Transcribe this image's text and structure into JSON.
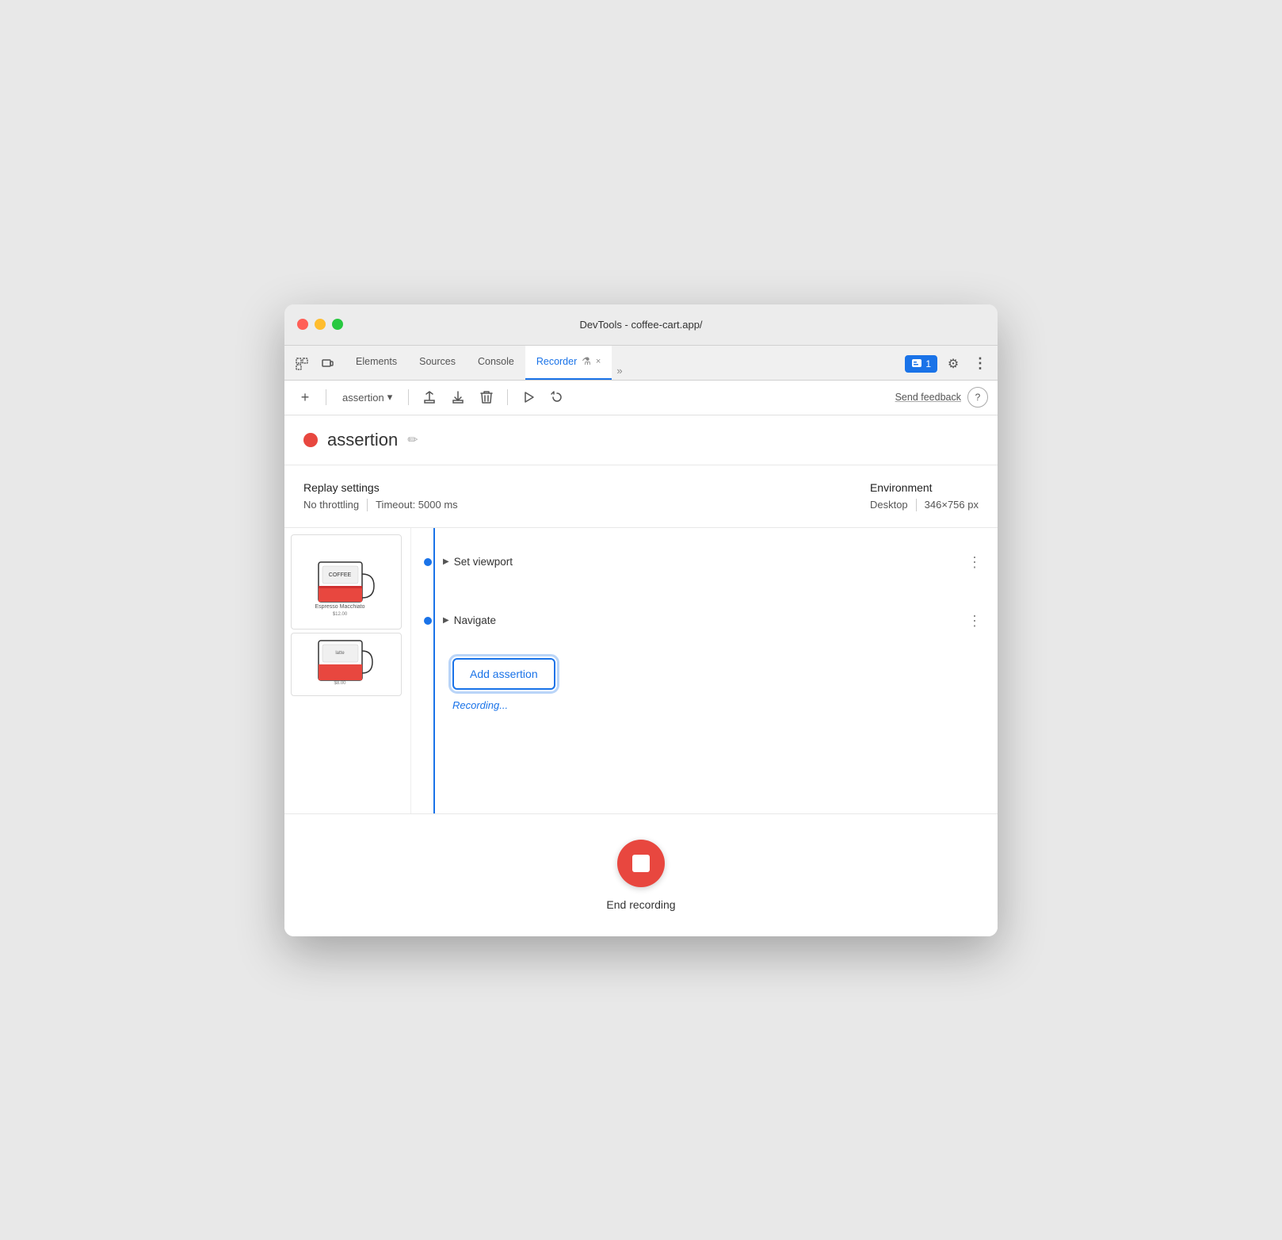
{
  "window": {
    "title": "DevTools - coffee-cart.app/"
  },
  "tabs": {
    "items": [
      {
        "id": "elements",
        "label": "Elements",
        "active": false
      },
      {
        "id": "sources",
        "label": "Sources",
        "active": false
      },
      {
        "id": "console",
        "label": "Console",
        "active": false
      },
      {
        "id": "recorder",
        "label": "Recorder",
        "active": true
      }
    ],
    "more_icon": "»",
    "close_icon": "×"
  },
  "toolbar": {
    "add_icon": "+",
    "recording_name": "assertion",
    "dropdown_icon": "▾",
    "export_icon": "↑",
    "download_icon": "↓",
    "delete_icon": "🗑",
    "play_icon": "▶",
    "step_icon": "↻",
    "send_feedback": "Send feedback",
    "help_icon": "?"
  },
  "header_bar": {
    "badge_label": "1",
    "settings_icon": "⚙",
    "more_icon": "⋮"
  },
  "recording": {
    "dot_color": "#e8473f",
    "name": "assertion",
    "edit_icon": "✏"
  },
  "replay_settings": {
    "title": "Replay settings",
    "throttling": "No throttling",
    "timeout": "Timeout: 5000 ms"
  },
  "environment": {
    "title": "Environment",
    "viewport": "Desktop",
    "resolution": "346×756 px"
  },
  "steps": [
    {
      "id": "set-viewport",
      "label": "Set viewport"
    },
    {
      "id": "navigate",
      "label": "Navigate"
    }
  ],
  "add_assertion": {
    "button_label": "Add assertion",
    "status": "Recording..."
  },
  "end_recording": {
    "label": "End recording"
  }
}
